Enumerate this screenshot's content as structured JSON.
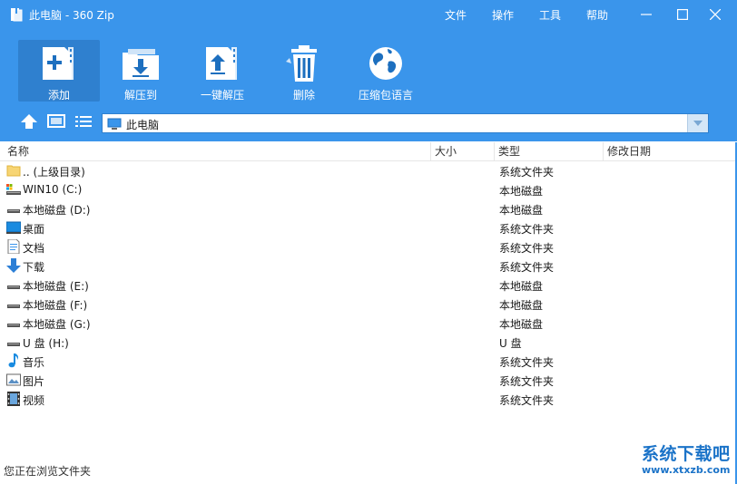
{
  "window": {
    "title": "此电脑 - 360 Zip"
  },
  "menu": [
    "文件",
    "操作",
    "工具",
    "帮助"
  ],
  "toolbar": [
    {
      "label": "添加",
      "icon": "add-to-archive-icon"
    },
    {
      "label": "解压到",
      "icon": "extract-to-icon"
    },
    {
      "label": "一键解压",
      "icon": "one-click-extract-icon"
    },
    {
      "label": "删除",
      "icon": "trash-icon"
    },
    {
      "label": "压缩包语言",
      "icon": "globe-icon"
    }
  ],
  "address": {
    "value": "此电脑"
  },
  "columns": [
    "名称",
    "大小",
    "类型",
    "修改日期"
  ],
  "rows": [
    {
      "name": ".. (上级目录)",
      "type": "系统文件夹",
      "icon": "parent-folder-icon"
    },
    {
      "name": "WIN10 (C:)",
      "type": "本地磁盘",
      "icon": "system-drive-icon"
    },
    {
      "name": "本地磁盘 (D:)",
      "type": "本地磁盘",
      "icon": "drive-icon"
    },
    {
      "name": "桌面",
      "type": "系统文件夹",
      "icon": "desktop-icon"
    },
    {
      "name": "文档",
      "type": "系统文件夹",
      "icon": "document-icon"
    },
    {
      "name": "下载",
      "type": "系统文件夹",
      "icon": "download-icon"
    },
    {
      "name": "本地磁盘 (E:)",
      "type": "本地磁盘",
      "icon": "drive-icon"
    },
    {
      "name": "本地磁盘 (F:)",
      "type": "本地磁盘",
      "icon": "drive-icon"
    },
    {
      "name": "本地磁盘 (G:)",
      "type": "本地磁盘",
      "icon": "drive-icon"
    },
    {
      "name": "U 盘 (H:)",
      "type": "U 盘",
      "icon": "usb-drive-icon"
    },
    {
      "name": "音乐",
      "type": "系统文件夹",
      "icon": "music-icon"
    },
    {
      "name": "图片",
      "type": "系统文件夹",
      "icon": "picture-icon"
    },
    {
      "name": "视频",
      "type": "系统文件夹",
      "icon": "video-icon"
    }
  ],
  "status": "您正在浏览文件夹",
  "watermark": {
    "main": "系统下载吧",
    "url": "www.xtxzb.com"
  },
  "colors": {
    "accent": "#3a95eb",
    "active": "#2f80cf"
  }
}
